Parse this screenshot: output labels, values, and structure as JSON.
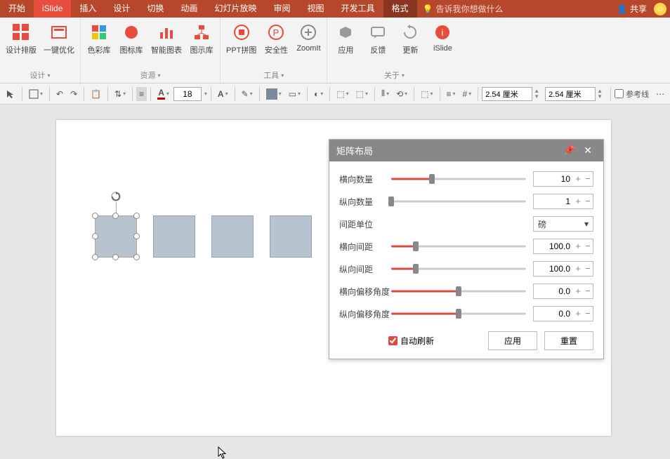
{
  "menu": {
    "tabs": [
      "开始",
      "iSlide",
      "插入",
      "设计",
      "切换",
      "动画",
      "幻灯片放映",
      "审阅",
      "视图",
      "开发工具",
      "格式"
    ],
    "active_tab": "iSlide",
    "format_tab": "格式",
    "tell_me": "告诉我你想做什么",
    "share": "共享"
  },
  "ribbon": {
    "groups": [
      {
        "label": "设计",
        "items": [
          {
            "label": "设计排版"
          },
          {
            "label": "一键优化"
          }
        ]
      },
      {
        "label": "资源",
        "items": [
          {
            "label": "色彩库"
          },
          {
            "label": "图标库"
          },
          {
            "label": "智能图表"
          },
          {
            "label": "图示库"
          }
        ]
      },
      {
        "label": "工具",
        "items": [
          {
            "label": "PPT拼图"
          },
          {
            "label": "安全性"
          },
          {
            "label": "ZoomIt"
          }
        ]
      },
      {
        "label": "关于",
        "items": [
          {
            "label": "应用"
          },
          {
            "label": "反馈"
          },
          {
            "label": "更新"
          },
          {
            "label": "iSlide"
          }
        ]
      }
    ]
  },
  "toolbar2": {
    "font_size": "18",
    "width": "2.54 厘米",
    "height": "2.54 厘米",
    "guides": "参考线"
  },
  "panel": {
    "title": "矩阵布局",
    "rows": {
      "h_count": {
        "label": "横向数量",
        "value": "10",
        "fill": 30
      },
      "v_count": {
        "label": "纵向数量",
        "value": "1",
        "fill": 0
      },
      "unit": {
        "label": "间距单位",
        "value": "磅"
      },
      "h_gap": {
        "label": "横向间距",
        "value": "100.0",
        "fill": 18
      },
      "v_gap": {
        "label": "纵向间距",
        "value": "100.0",
        "fill": 18
      },
      "h_off": {
        "label": "横向偏移角度",
        "value": "0.0",
        "fill": 50
      },
      "v_off": {
        "label": "纵向偏移角度",
        "value": "0.0",
        "fill": 50
      }
    },
    "auto_refresh": "自动刷新",
    "apply": "应用",
    "reset": "重置"
  }
}
